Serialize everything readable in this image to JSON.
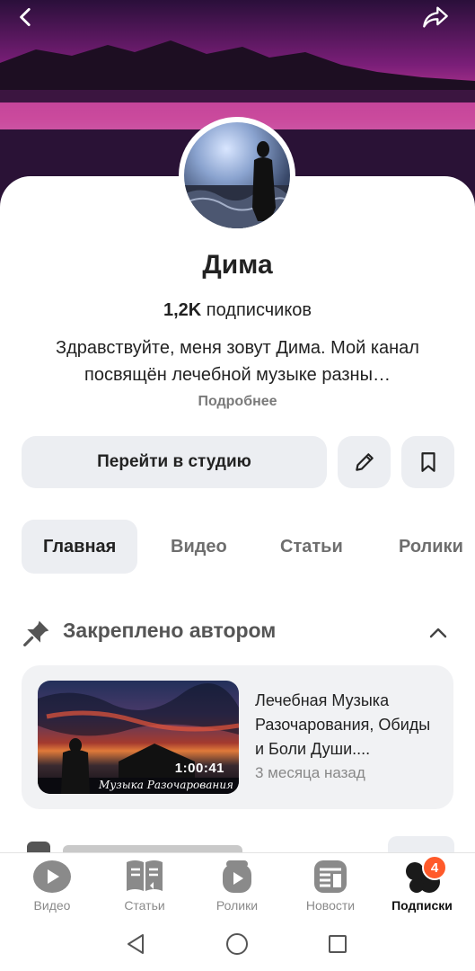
{
  "header": {
    "back_icon": "chevron-left-icon",
    "share_icon": "share-arrow-icon"
  },
  "channel": {
    "name": "Дима",
    "subscribers_count": "1,2K",
    "subscribers_label": "подписчиков",
    "description": "Здравствуйте, меня зовут Дима. Мой канал посвящён лечебной музыке разны…",
    "more_label": "Подробнее"
  },
  "actions": {
    "studio_label": "Перейти в студию",
    "edit_icon": "pencil-icon",
    "bookmark_icon": "bookmark-icon"
  },
  "tabs": [
    {
      "label": "Главная",
      "active": true
    },
    {
      "label": "Видео",
      "active": false
    },
    {
      "label": "Статьи",
      "active": false
    },
    {
      "label": "Ролики",
      "active": false
    }
  ],
  "pinned": {
    "title": "Закреплено автором",
    "icon": "pin-icon",
    "collapse_icon": "chevron-up-icon",
    "video": {
      "title": "Лечебная Музыка Разочарования, Обиды и Боли Души....",
      "age": "3 месяца назад",
      "duration": "1:00:41",
      "thumb_caption": "Музыка Разочарования"
    }
  },
  "bottom_nav": [
    {
      "label": "Видео",
      "icon": "video-play-icon",
      "active": false
    },
    {
      "label": "Статьи",
      "icon": "articles-book-icon",
      "active": false
    },
    {
      "label": "Ролики",
      "icon": "shorts-icon",
      "active": false
    },
    {
      "label": "Новости",
      "icon": "news-icon",
      "active": false
    },
    {
      "label": "Подписки",
      "icon": "subscriptions-icon",
      "active": true,
      "badge": "4"
    }
  ],
  "colors": {
    "accent_badge": "#ff5a2a",
    "button_bg": "#eceef2",
    "card_bg": "#f1f2f4"
  }
}
